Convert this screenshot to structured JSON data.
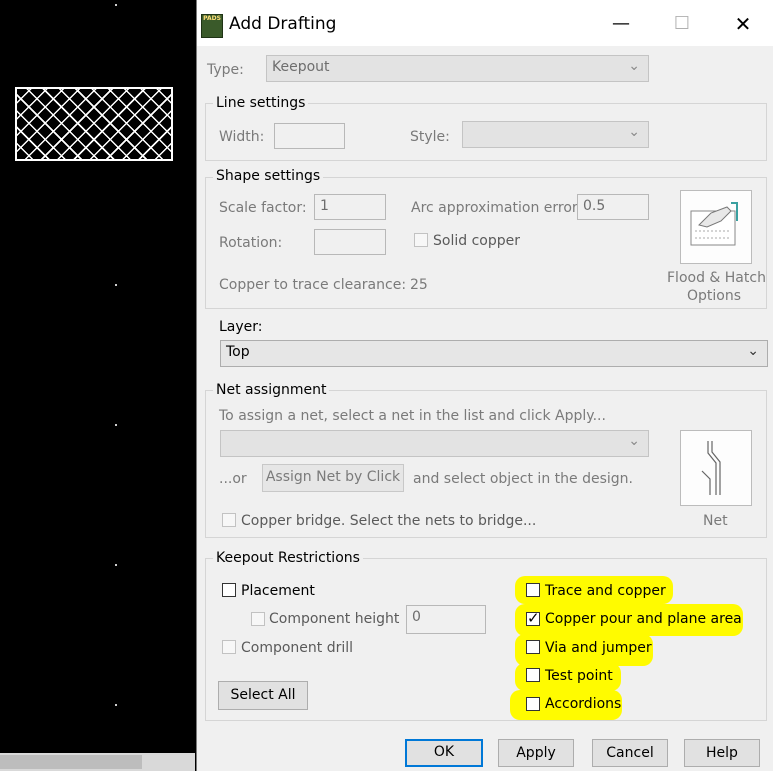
{
  "dialog": {
    "title": "Add Drafting",
    "app_icon_text": "PADS",
    "controls": {
      "minimize": "—",
      "maximize": "☐",
      "close": "✕"
    }
  },
  "type": {
    "label": "Type:",
    "value": "Keepout"
  },
  "line_settings": {
    "title": "Line settings",
    "width_label": "Width:",
    "width_value": "",
    "style_label": "Style:",
    "style_value": ""
  },
  "shape_settings": {
    "title": "Shape settings",
    "scale_label": "Scale factor:",
    "scale_value": "1",
    "arc_label": "Arc approximation error:",
    "arc_value": "0.5",
    "rotation_label": "Rotation:",
    "rotation_value": "",
    "solid_copper_label": "Solid copper",
    "clearance_label": "Copper to trace clearance:",
    "clearance_value": "25",
    "flood_label_1": "Flood & Hatch",
    "flood_label_2": "Options"
  },
  "layer": {
    "label": "Layer:",
    "value": "Top"
  },
  "net_assignment": {
    "title": "Net assignment",
    "hint": "To assign a net, select a net in the list and click Apply...",
    "net_value": "",
    "or_label": "...or",
    "assign_button": "Assign Net by Click",
    "select_hint": "and select object in the design.",
    "copper_bridge_label": "Copper bridge. Select the nets to bridge...",
    "net_button_label": "Net"
  },
  "keepout": {
    "title": "Keepout Restrictions",
    "placement": {
      "label": "Placement",
      "checked": false
    },
    "component_height": {
      "label": "Component height",
      "value": "0",
      "checked": false
    },
    "component_drill": {
      "label": "Component drill",
      "checked": false
    },
    "select_all": "Select All",
    "trace_copper": {
      "label": "Trace and copper",
      "checked": false
    },
    "copper_pour": {
      "label": "Copper pour and plane area",
      "checked": true
    },
    "via_jumper": {
      "label": "Via and jumper",
      "checked": false
    },
    "test_point": {
      "label": "Test point",
      "checked": false
    },
    "accordions": {
      "label": "Accordions",
      "checked": false
    },
    "highlight_color": "#fffb00"
  },
  "buttons": {
    "ok": "OK",
    "apply": "Apply",
    "cancel": "Cancel",
    "help": "Help"
  }
}
